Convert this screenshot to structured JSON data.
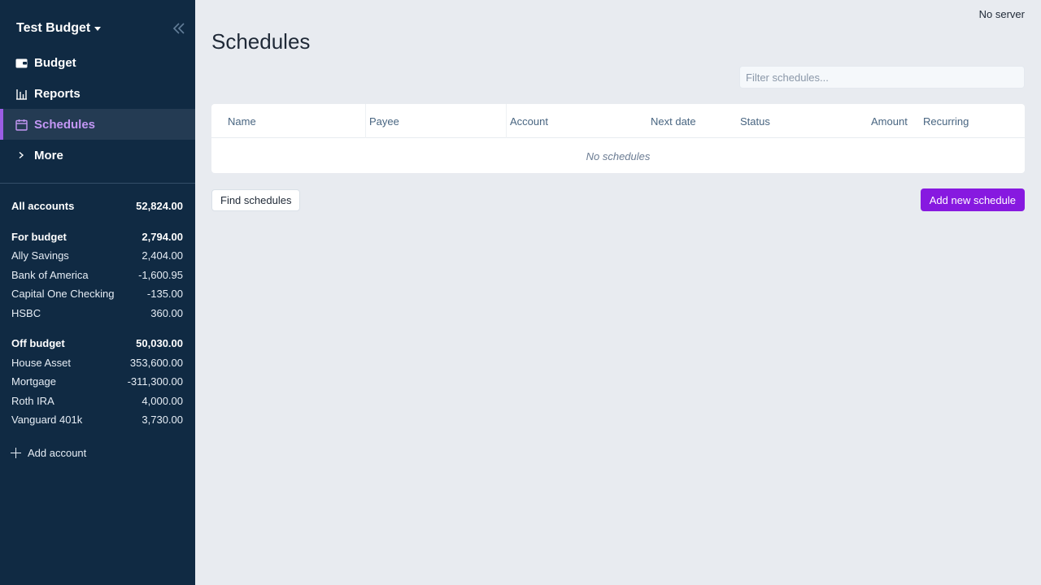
{
  "sidebar": {
    "budget_name": "Test Budget",
    "nav": [
      {
        "label": "Budget",
        "icon": "wallet-icon"
      },
      {
        "label": "Reports",
        "icon": "bar-chart-icon"
      },
      {
        "label": "Schedules",
        "icon": "calendar-icon",
        "active": true
      },
      {
        "label": "More",
        "icon": "chevron-right-icon"
      }
    ],
    "accounts": {
      "all": {
        "name": "All accounts",
        "balance": "52,824.00"
      },
      "for_budget": {
        "name": "For budget",
        "balance": "2,794.00",
        "items": [
          {
            "name": "Ally Savings",
            "balance": "2,404.00"
          },
          {
            "name": "Bank of America",
            "balance": "-1,600.95"
          },
          {
            "name": "Capital One Checking",
            "balance": "-135.00"
          },
          {
            "name": "HSBC",
            "balance": "360.00"
          }
        ]
      },
      "off_budget": {
        "name": "Off budget",
        "balance": "50,030.00",
        "items": [
          {
            "name": "House Asset",
            "balance": "353,600.00"
          },
          {
            "name": "Mortgage",
            "balance": "-311,300.00"
          },
          {
            "name": "Roth IRA",
            "balance": "4,000.00"
          },
          {
            "name": "Vanguard 401k",
            "balance": "3,730.00"
          }
        ]
      }
    },
    "add_account_label": "Add account"
  },
  "header": {
    "server_status": "No server",
    "page_title": "Schedules"
  },
  "filter": {
    "placeholder": "Filter schedules...",
    "value": ""
  },
  "table": {
    "columns": [
      "Name",
      "Payee",
      "Account",
      "Next date",
      "Status",
      "Amount",
      "Recurring"
    ],
    "empty_message": "No schedules"
  },
  "actions": {
    "find_label": "Find schedules",
    "add_label": "Add new schedule"
  },
  "colors": {
    "sidebar_bg": "#102a43",
    "accent": "#8719e0",
    "active_nav_text": "#c397f5",
    "main_bg": "#e8ebf0"
  }
}
